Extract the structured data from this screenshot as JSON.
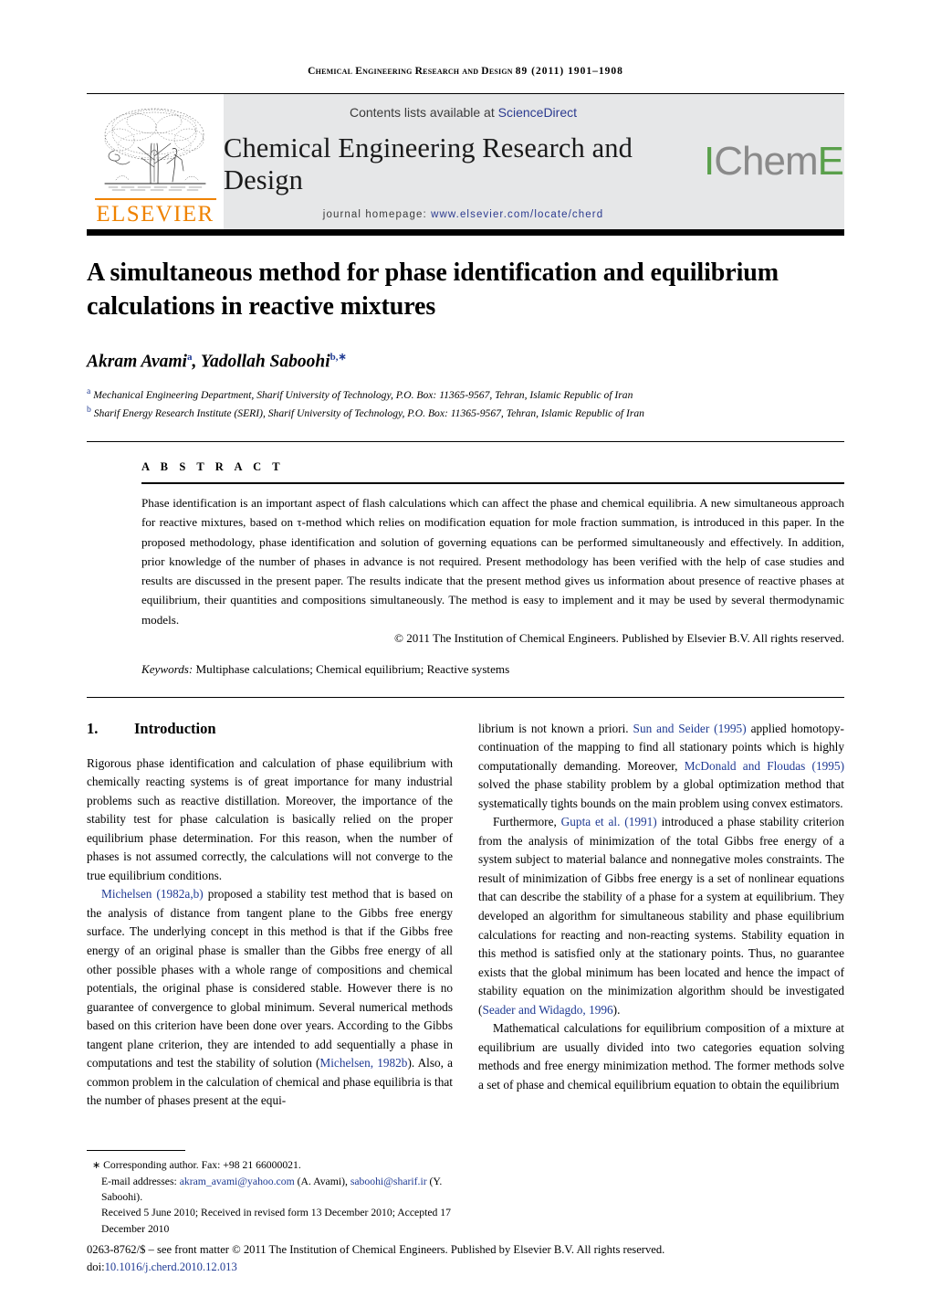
{
  "running_head": {
    "journal_caps": "Chemical Engineering Research and Design",
    "volume_year_pages": "89 (2011) 1901–1908"
  },
  "banner": {
    "contents_prefix": "Contents lists available at",
    "sciencedirect": "ScienceDirect",
    "journal_title": "Chemical Engineering Research and Design",
    "homepage_label": "journal homepage:",
    "homepage_url": "www.elsevier.com/locate/cherd",
    "elsevier_wordmark": "ELSEVIER",
    "icheme_part1": "I",
    "icheme_part2": "Chem",
    "icheme_part3": "E",
    "colors": {
      "elsevier_orange": "#ef8200",
      "icheme_green": "#5aa04b",
      "icheme_gray": "#8a8a8a",
      "link_blue": "#2b3a8f",
      "banner_gray": "#e6e7e8"
    }
  },
  "article": {
    "title": "A simultaneous method for phase identification and equilibrium calculations in reactive mixtures",
    "authors_html": "Akram Avami<sup>a</sup>, Yadollah Saboohi<sup>b,∗</sup>",
    "author_list": [
      {
        "name": "Akram Avami",
        "marker": "a"
      },
      {
        "name": "Yadollah Saboohi",
        "marker": "b,∗"
      }
    ],
    "affiliations": [
      {
        "marker": "a",
        "text": "Mechanical Engineering Department, Sharif University of Technology, P.O. Box: 11365-9567, Tehran, Islamic Republic of Iran"
      },
      {
        "marker": "b",
        "text": "Sharif Energy Research Institute (SERI), Sharif University of Technology, P.O. Box: 11365-9567, Tehran, Islamic Republic of Iran"
      }
    ]
  },
  "abstract": {
    "heading": "A B S T R A C T",
    "text": "Phase identification is an important aspect of flash calculations which can affect the phase and chemical equilibria. A new simultaneous approach for reactive mixtures, based on τ-method which relies on modification equation for mole fraction summation, is introduced in this paper. In the proposed methodology, phase identification and solution of governing equations can be performed simultaneously and effectively. In addition, prior knowledge of the number of phases in advance is not required. Present methodology has been verified with the help of case studies and results are discussed in the present paper. The results indicate that the present method gives us information about presence of reactive phases at equilibrium, their quantities and compositions simultaneously. The method is easy to implement and it may be used by several thermodynamic models.",
    "copyright": "© 2011 The Institution of Chemical Engineers. Published by Elsevier B.V. All rights reserved.",
    "keywords_label": "Keywords:",
    "keywords_value": "Multiphase calculations; Chemical equilibrium; Reactive systems"
  },
  "section": {
    "number": "1.",
    "title": "Introduction"
  },
  "left_column": {
    "paragraphs": [
      "Rigorous phase identification and calculation of phase equilibrium with chemically reacting systems is of great importance for many industrial problems such as reactive distillation. Moreover, the importance of the stability test for phase calculation is basically relied on the proper equilibrium phase determination. For this reason, when the number of phases is not assumed correctly, the calculations will not converge to the true equilibrium conditions."
    ],
    "paragraph2_parts": [
      {
        "type": "cite",
        "text": "Michelsen (1982a,b)"
      },
      {
        "type": "text",
        "text": " proposed a stability test method that is based on the analysis of distance from tangent plane to the Gibbs free energy surface. The underlying concept in this method is that if the Gibbs free energy of an original phase is smaller than the Gibbs free energy of all other possible phases with a whole range of compositions and chemical potentials, the original phase is considered stable. However there is no guarantee of convergence to global minimum. Several numerical methods based on this criterion have been done over years. According to the Gibbs tangent plane criterion, they are intended to add sequentially a phase in computations and test the stability of solution ("
      },
      {
        "type": "cite",
        "text": "Michelsen, 1982b"
      },
      {
        "type": "text",
        "text": "). Also, a common problem in the calculation of chemical and phase equilibria is that the number of phases present at the equi-"
      }
    ]
  },
  "right_column": {
    "paragraph1_parts": [
      {
        "type": "text",
        "text": "librium is not known a priori. "
      },
      {
        "type": "cite",
        "text": "Sun and Seider (1995)"
      },
      {
        "type": "text",
        "text": " applied homotopy-continuation of the mapping to find all stationary points which is highly computationally demanding. Moreover, "
      },
      {
        "type": "cite",
        "text": "McDonald and Floudas (1995)"
      },
      {
        "type": "text",
        "text": " solved the phase stability problem by a global optimization method that systematically tights bounds on the main problem using convex estimators."
      }
    ],
    "paragraph2_parts": [
      {
        "type": "text",
        "text": "Furthermore, "
      },
      {
        "type": "cite",
        "text": "Gupta et al. (1991)"
      },
      {
        "type": "text",
        "text": " introduced a phase stability criterion from the analysis of minimization of the total Gibbs free energy of a system subject to material balance and nonnegative moles constraints. The result of minimization of Gibbs free energy is a set of nonlinear equations that can describe the stability of a phase for a system at equilibrium. They developed an algorithm for simultaneous stability and phase equilibrium calculations for reacting and non-reacting systems. Stability equation in this method is satisfied only at the stationary points. Thus, no guarantee exists that the global minimum has been located and hence the impact of stability equation on the minimization algorithm should be investigated ("
      },
      {
        "type": "cite",
        "text": "Seader and Widagdo, 1996"
      },
      {
        "type": "text",
        "text": ")."
      }
    ],
    "paragraph3_parts": [
      {
        "type": "text",
        "text": "Mathematical calculations for equilibrium composition of a mixture at equilibrium are usually divided into two categories equation solving methods and free energy minimization method. The former methods solve a set of phase and chemical equilibrium equation to obtain the equilibrium"
      }
    ]
  },
  "footnote": {
    "corresponding": "Corresponding author. Fax: +98 21 66000021.",
    "email_label": "E-mail addresses:",
    "email1": "akram_avami@yahoo.com",
    "email1_owner": "(A. Avami),",
    "email2": "saboohi@sharif.ir",
    "email2_owner": "(Y. Saboohi).",
    "received": "Received 5 June 2010; Received in revised form 13 December 2010; Accepted 17 December 2010"
  },
  "issn": {
    "line": "0263-8762/$ – see front matter © 2011 The Institution of Chemical Engineers. Published by Elsevier B.V. All rights reserved.",
    "doi_label": "doi:",
    "doi_value": "10.1016/j.cherd.2010.12.013"
  }
}
